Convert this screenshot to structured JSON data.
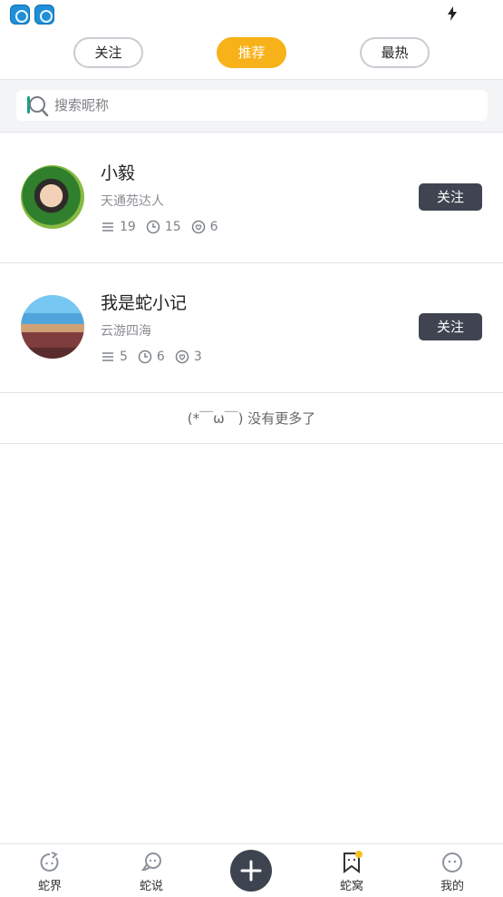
{
  "status_bar": {
    "app_icon_1": "app-icon",
    "app_icon_2": "app-icon",
    "battery_icon": "charge-icon"
  },
  "tabs": [
    {
      "label": "关注",
      "active": false
    },
    {
      "label": "推荐",
      "active": true
    },
    {
      "label": "最热",
      "active": false
    }
  ],
  "search": {
    "placeholder": "搜索昵称",
    "icon": "search-icon"
  },
  "users": [
    {
      "name": "小毅",
      "title": "天通苑达人",
      "stats": {
        "posts": "19",
        "history": "15",
        "likes": "6"
      },
      "follow_label": "关注"
    },
    {
      "name": "我是蛇小记",
      "title": "云游四海",
      "stats": {
        "posts": "5",
        "history": "6",
        "likes": "3"
      },
      "follow_label": "关注"
    }
  ],
  "end_message": "(*￣ω￣) 没有更多了",
  "bottom_nav": [
    {
      "label": "蛇界",
      "icon": "refresh-icon"
    },
    {
      "label": "蛇说",
      "icon": "chat-icon"
    },
    {
      "label": "",
      "icon": "add-icon"
    },
    {
      "label": "蛇窝",
      "icon": "bookmark-icon"
    },
    {
      "label": "我的",
      "icon": "face-icon"
    }
  ],
  "colors": {
    "accent": "#f7b21a",
    "button_dark": "#3f4450",
    "background_gray": "#f3f4f6",
    "icon_gray": "#7d828a"
  }
}
